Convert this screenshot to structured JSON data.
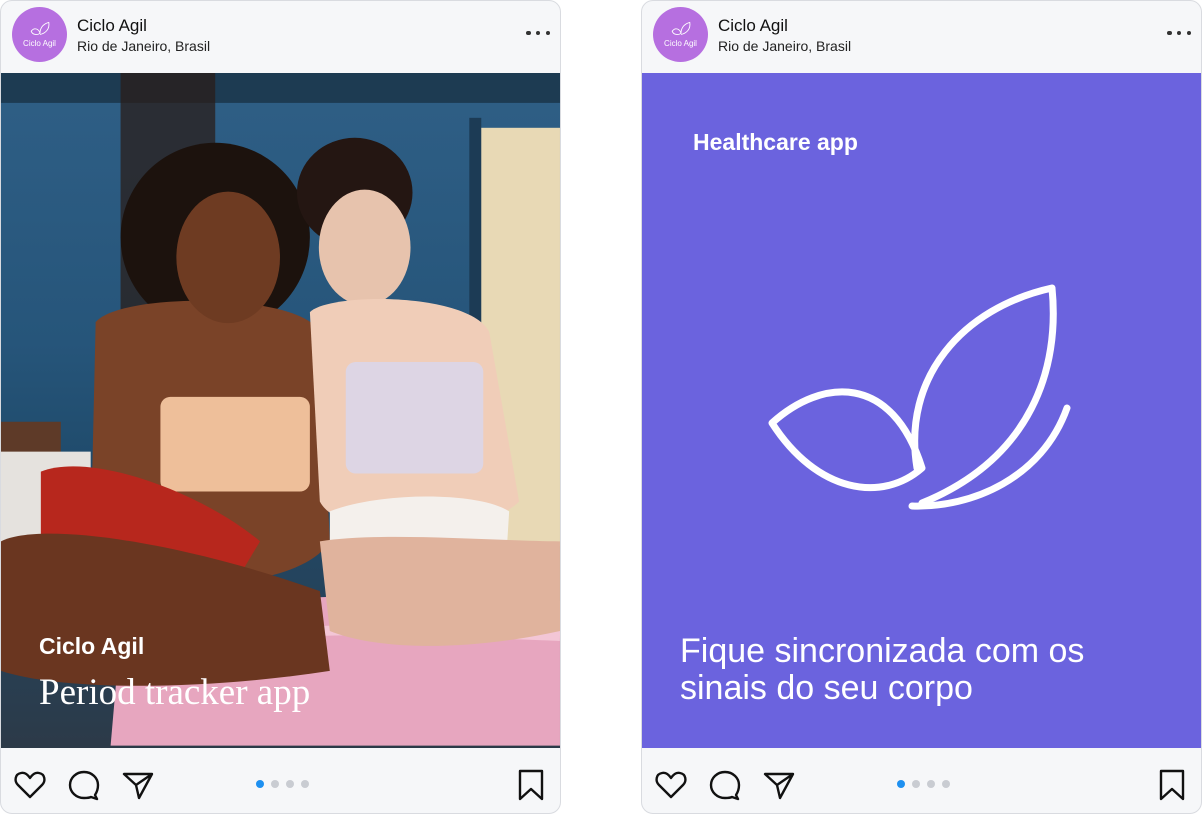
{
  "posts": [
    {
      "account": {
        "name": "Ciclo Agil",
        "location": "Rio de Janeiro, Brasil",
        "avatar_text": "Ciclo Agil"
      },
      "overlay": {
        "title": "Ciclo Agil",
        "subtitle": "Period tracker app"
      },
      "carousel": {
        "total": 4,
        "active": 1
      }
    },
    {
      "account": {
        "name": "Ciclo Agil",
        "location": "Rio de Janeiro, Brasil",
        "avatar_text": "Ciclo Agil"
      },
      "slide": {
        "kicker": "Healthcare app",
        "headline": "Fique sincronizada com os sinais do seu corpo"
      },
      "carousel": {
        "total": 4,
        "active": 1
      }
    }
  ],
  "colors": {
    "brand_purple": "#6b63de",
    "avatar_purple": "#b66fe0",
    "dot_active": "#1e90f0",
    "dot_inactive": "#c9ccd2"
  },
  "icons": [
    "more-icon",
    "heart-icon",
    "comment-icon",
    "send-icon",
    "bookmark-icon",
    "butterfly-logo-icon"
  ]
}
